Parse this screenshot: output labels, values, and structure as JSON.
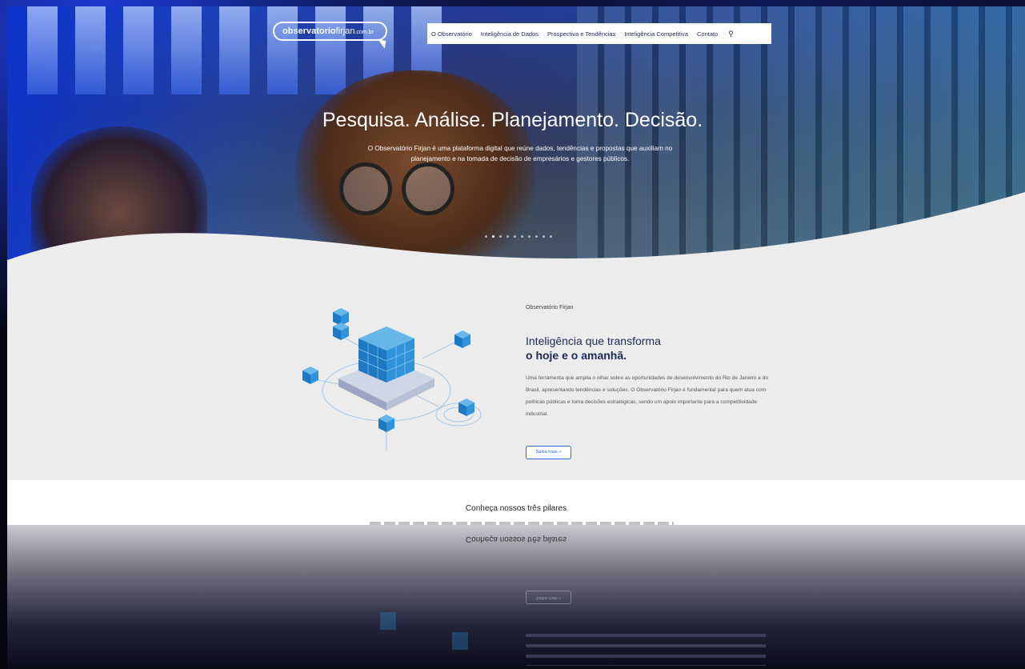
{
  "header": {
    "logo_bold": "observatorio",
    "logo_light": "firjan",
    "logo_suffix": ".com.br",
    "nav": [
      {
        "label": "O Observatório"
      },
      {
        "label": "Inteligência de Dados"
      },
      {
        "label": "Prospectiva e Tendências"
      },
      {
        "label": "Inteligência Competitiva"
      },
      {
        "label": "Contato"
      }
    ],
    "search_icon": "search-icon"
  },
  "hero": {
    "title": "Pesquisa. Análise. Planejamento. Decisão.",
    "subtitle": "O Observatório Firjan é uma plataforma digital que reúne dados, tendências e propostas que auxiliam no planejamento e na tomada de decisão de empresários e gestores públicos.",
    "slides_count": 10,
    "active_slide": 1
  },
  "about": {
    "kicker": "Observatório Firjan",
    "heading_line1": "Inteligência que transforma",
    "heading_line2": "o hoje e o amanhã.",
    "paragraph": "Uma ferramenta que amplia o olhar sobre as oportunidades de desenvolvimento do Rio de Janeiro e do Brasil, apresentando tendências e soluções. O Observatório Firjan é fundamental para quem atua com políticas públicas e toma decisões estratégicas, sendo um apoio importante para a competitividade industrial.",
    "button_label": "Saiba mais  »"
  },
  "pillars": {
    "title": "Conheça nossos três pilares"
  },
  "colors": {
    "brand_navy": "#1d2a5a",
    "accent_blue": "#2d6cd6",
    "cube_blue": "#2a8bd0"
  }
}
